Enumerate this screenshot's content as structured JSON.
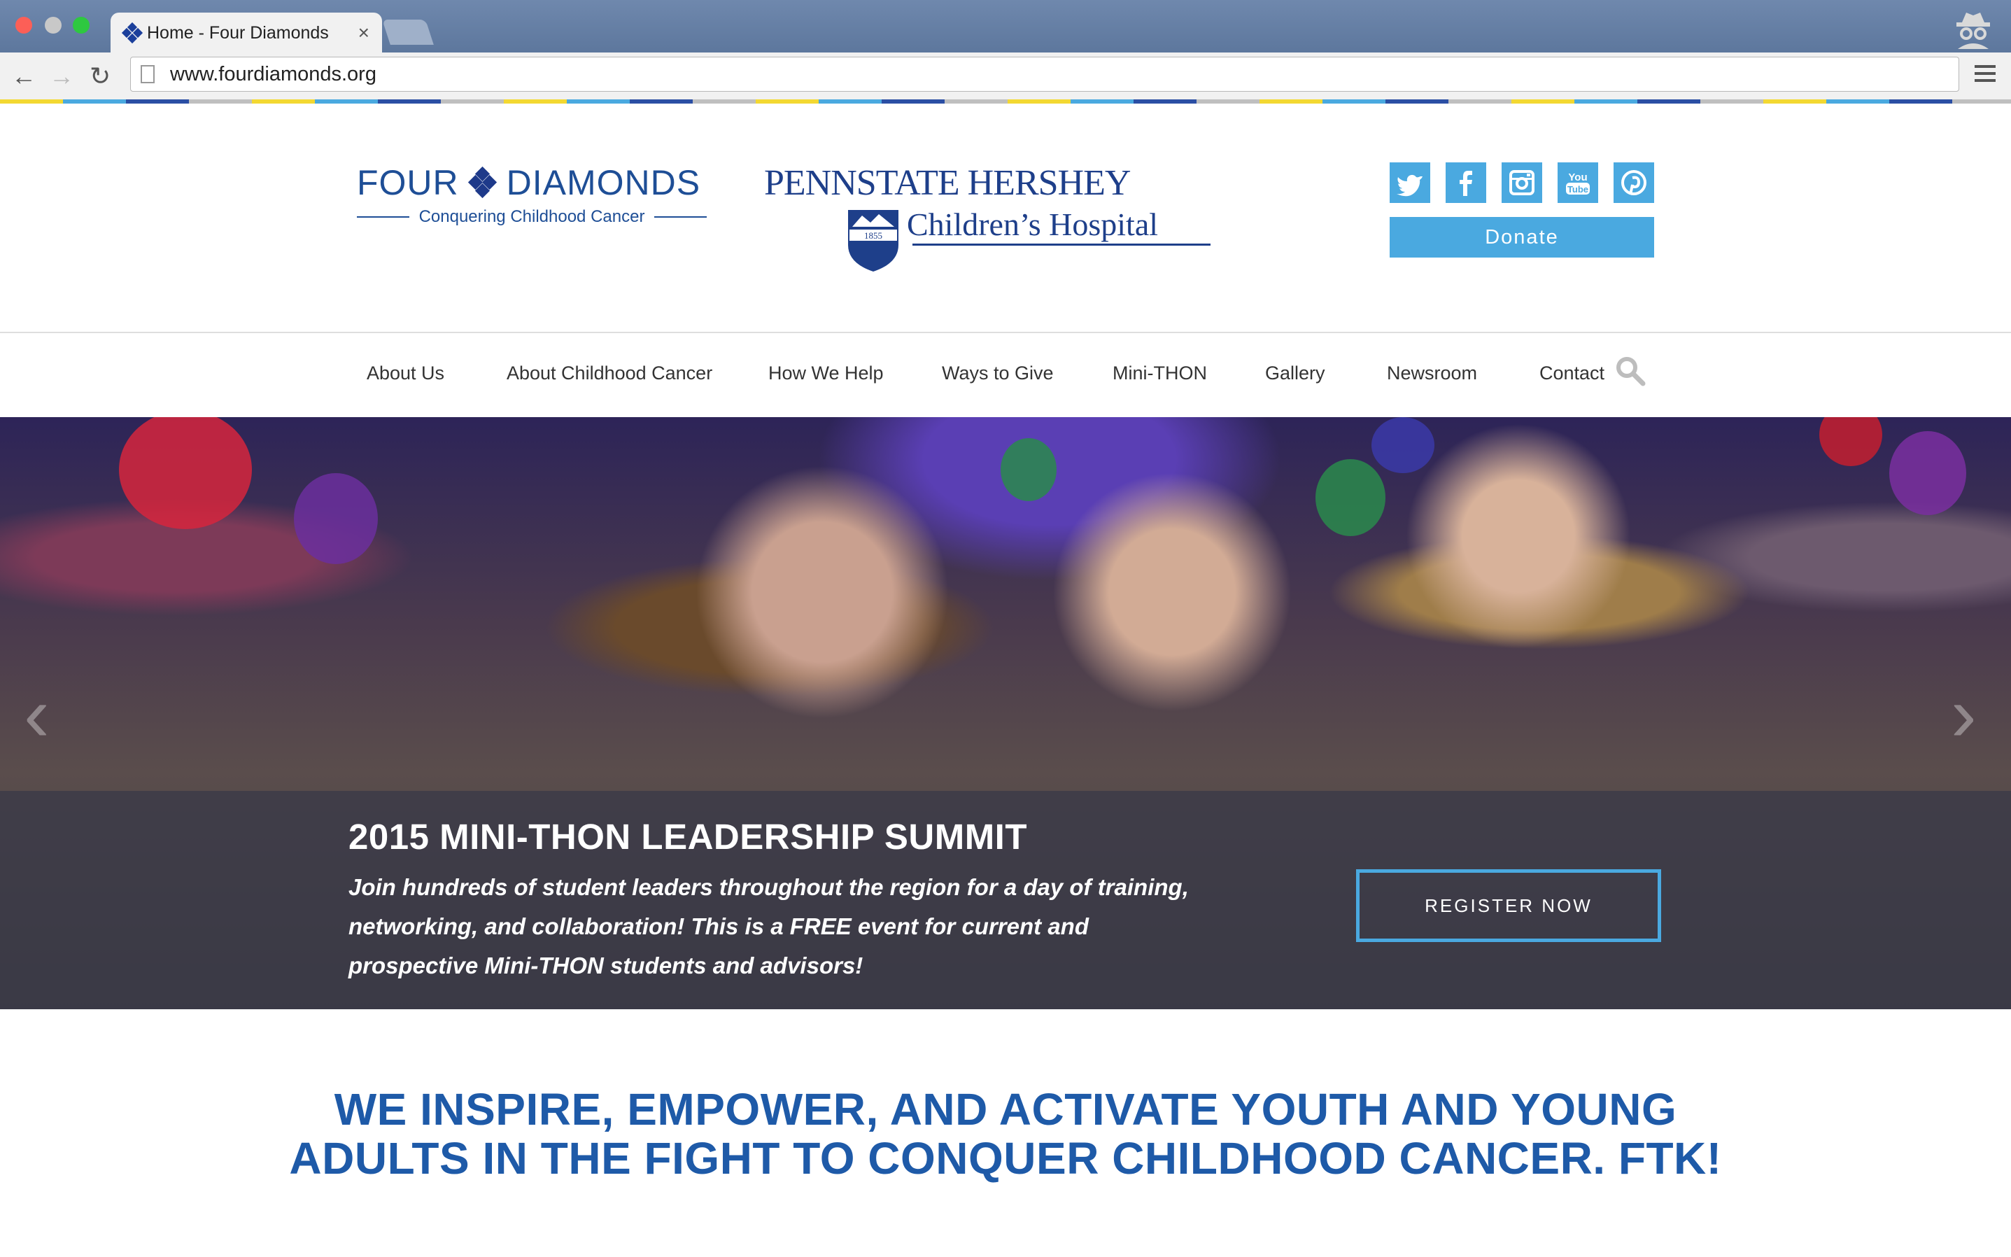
{
  "browser": {
    "tab_title": "Home - Four Diamonds",
    "tab_close": "×",
    "url": "www.fourdiamonds.org",
    "back": "←",
    "forward": "→",
    "reload": "↻"
  },
  "header": {
    "fd_logo": {
      "name_left": "FOUR",
      "name_right": "DIAMONDS",
      "tagline": "Conquering Childhood Cancer"
    },
    "psh_logo": {
      "line1": "PENNSTATE HERSHEY",
      "line2": "Children’s Hospital",
      "year": "1855"
    },
    "social": [
      "twitter-icon",
      "facebook-icon",
      "instagram-icon",
      "youtube-icon",
      "pinterest-icon"
    ],
    "donate_label": "Donate"
  },
  "nav": {
    "items": [
      {
        "label": "About Us"
      },
      {
        "label": "About Childhood Cancer"
      },
      {
        "label": "How We Help"
      },
      {
        "label": "Ways to Give"
      },
      {
        "label": "Mini-THON"
      },
      {
        "label": "Gallery"
      },
      {
        "label": "Newsroom"
      },
      {
        "label": "Contact"
      }
    ],
    "search_icon": "search-icon"
  },
  "hero": {
    "title": "2015 MINI-THON LEADERSHIP SUMMIT",
    "body": "Join hundreds of student leaders throughout the region for a day of training, networking, and collaboration! This is a FREE event for current and prospective Mini-THON students and advisors!",
    "cta_label": "REGISTER NOW",
    "prev_arrow": "‹",
    "next_arrow": "›"
  },
  "mission": {
    "line1": "WE INSPIRE, EMPOWER, AND ACTIVATE YOUTH AND YOUNG",
    "line2": "ADULTS IN THE FIGHT TO CONQUER CHILDHOOD CANCER. FTK!"
  },
  "colors": {
    "brand_blue": "#1e4e96",
    "accent_blue": "#4aa9e0",
    "mission_blue": "#1e5aa8"
  }
}
